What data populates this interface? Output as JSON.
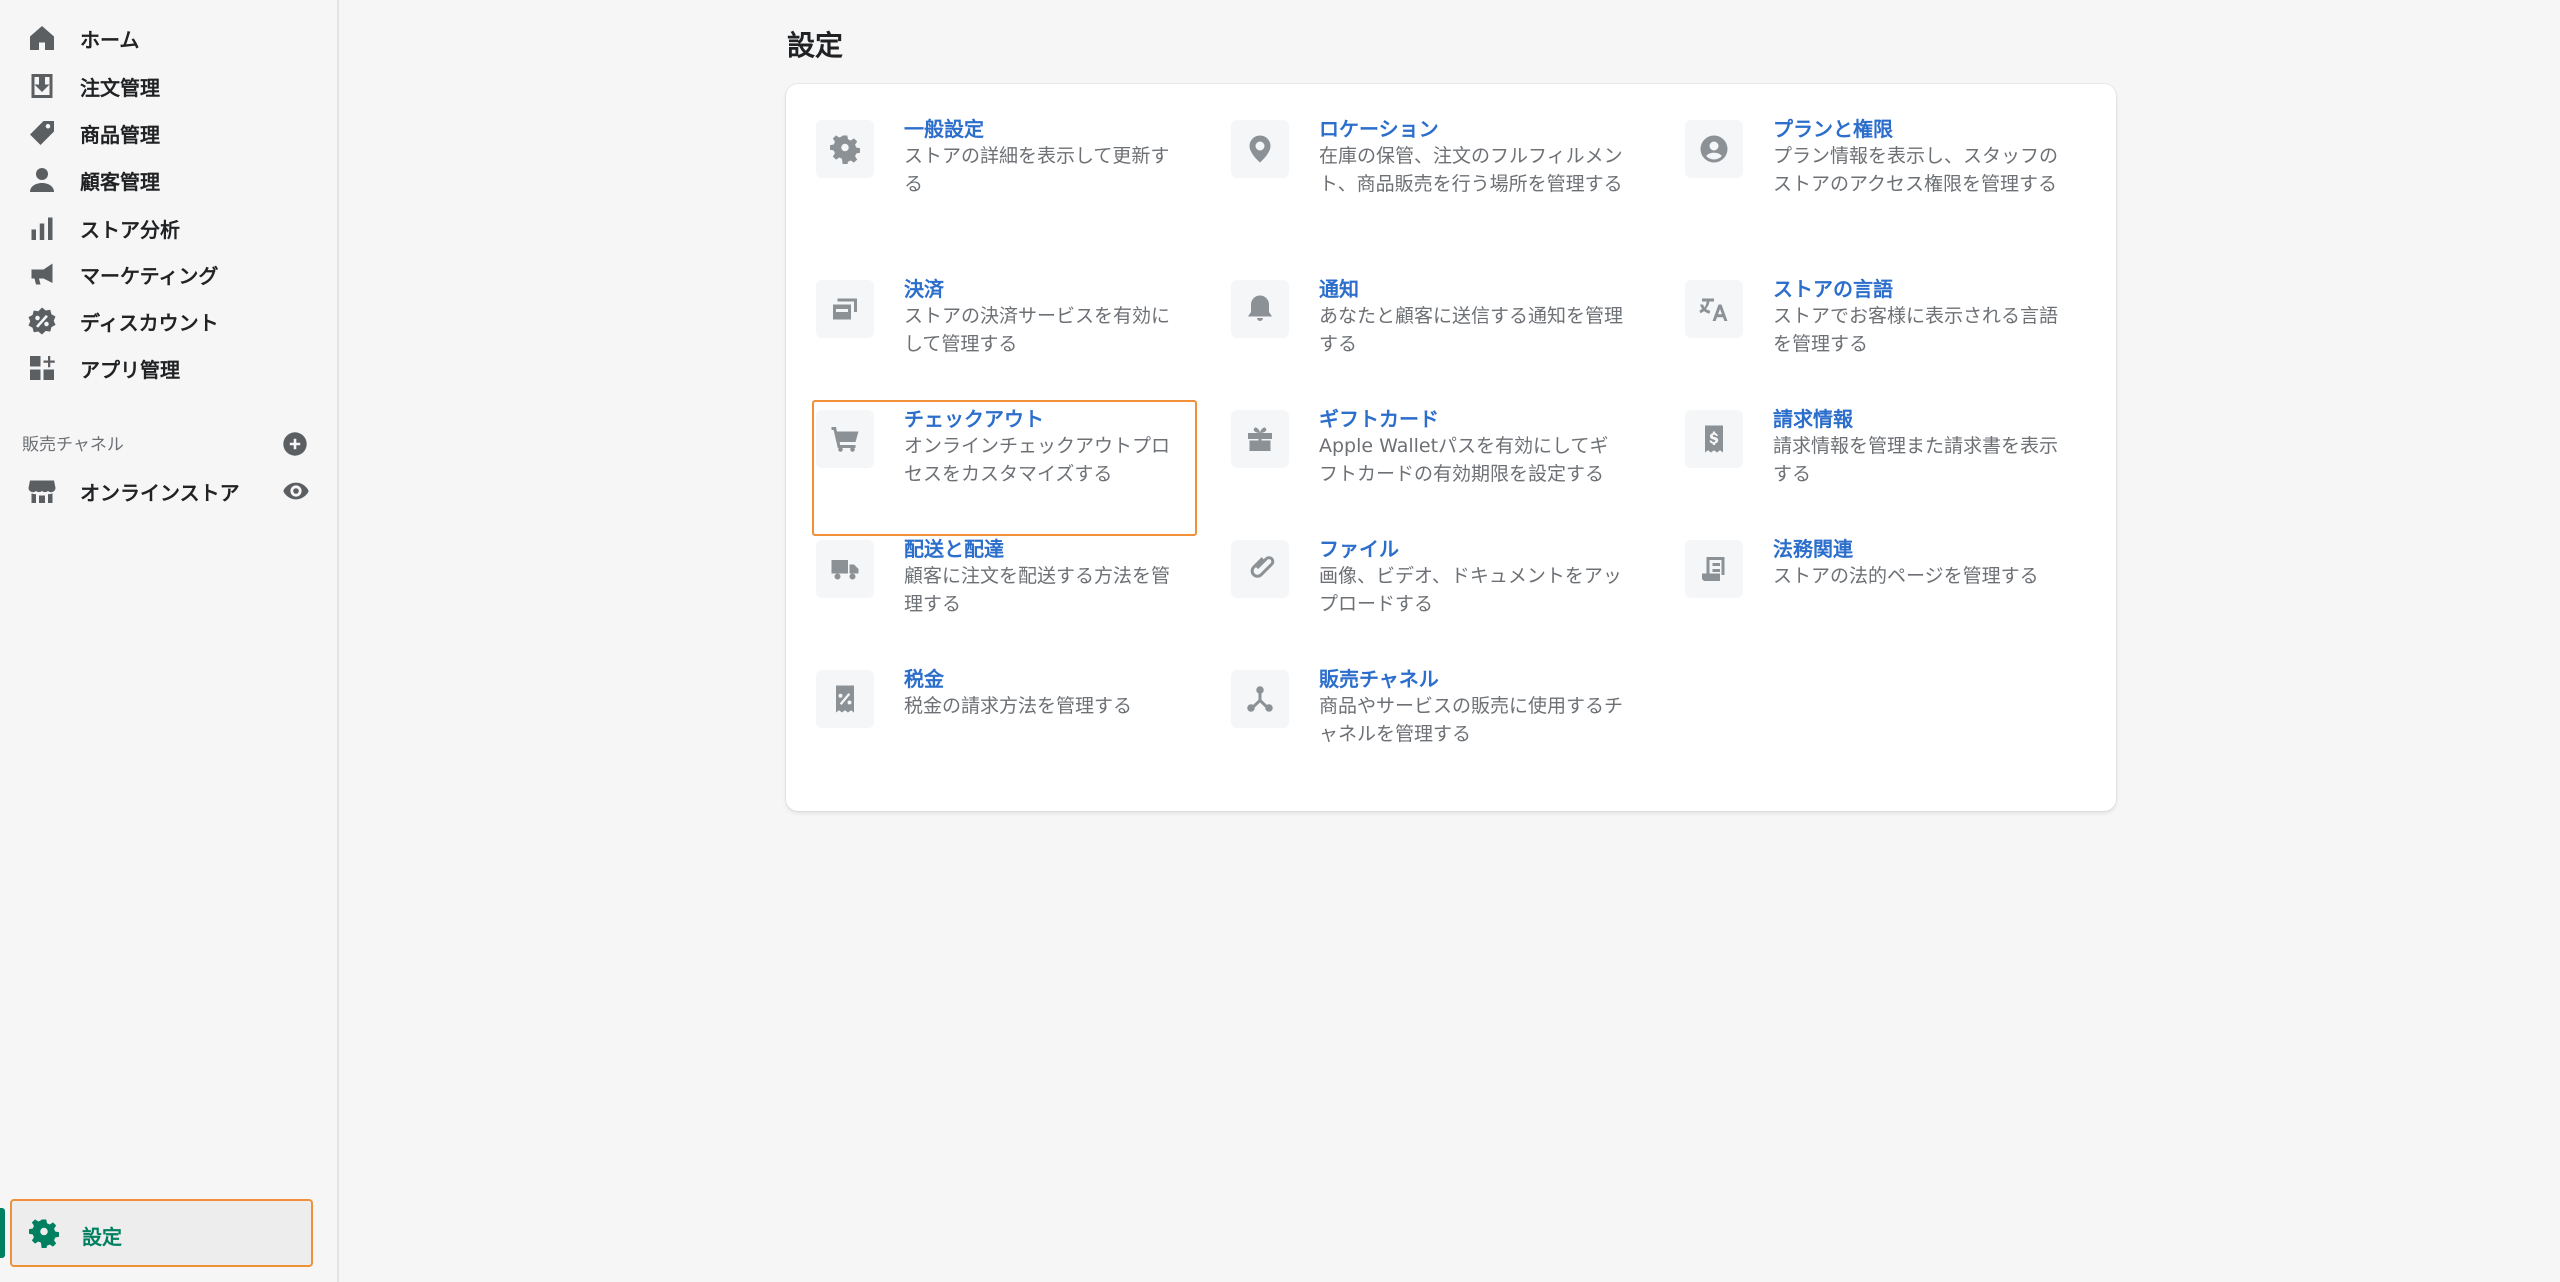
{
  "sidebar": {
    "nav": [
      {
        "label": "ホーム",
        "icon": "home-icon"
      },
      {
        "label": "注文管理",
        "icon": "orders-icon"
      },
      {
        "label": "商品管理",
        "icon": "tag-icon"
      },
      {
        "label": "顧客管理",
        "icon": "customer-icon"
      },
      {
        "label": "ストア分析",
        "icon": "analytics-icon"
      },
      {
        "label": "マーケティング",
        "icon": "megaphone-icon"
      },
      {
        "label": "ディスカウント",
        "icon": "discount-icon"
      },
      {
        "label": "アプリ管理",
        "icon": "apps-icon"
      }
    ],
    "channels_header": "販売チャネル",
    "channels": [
      {
        "label": "オンラインストア",
        "icon": "store-icon"
      }
    ],
    "settings_label": "設定"
  },
  "page": {
    "title": "設定"
  },
  "settings": [
    {
      "title": "一般設定",
      "desc": "ストアの詳細を表示して更新する",
      "icon": "gear-icon"
    },
    {
      "title": "ロケーション",
      "desc": "在庫の保管、注文のフルフィルメント、商品販売を行う場所を管理する",
      "icon": "location-icon"
    },
    {
      "title": "プランと権限",
      "desc": "プラン情報を表示し、スタッフのストアのアクセス権限を管理する",
      "icon": "user-circle-icon"
    },
    {
      "title": "決済",
      "desc": "ストアの決済サービスを有効にして管理する",
      "icon": "payment-icon"
    },
    {
      "title": "通知",
      "desc": "あなたと顧客に送信する通知を管理する",
      "icon": "bell-icon"
    },
    {
      "title": "ストアの言語",
      "desc": "ストアでお客様に表示される言語を管理する",
      "icon": "translate-icon"
    },
    {
      "title": "チェックアウト",
      "desc": "オンラインチェックアウトプロセスをカスタマイズする",
      "icon": "cart-icon"
    },
    {
      "title": "ギフトカード",
      "desc": "Apple Walletパスを有効にしてギフトカードの有効期限を設定する",
      "icon": "gift-icon"
    },
    {
      "title": "請求情報",
      "desc": "請求情報を管理また請求書を表示する",
      "icon": "receipt-icon"
    },
    {
      "title": "配送と配達",
      "desc": "顧客に注文を配送する方法を管理する",
      "icon": "truck-icon"
    },
    {
      "title": "ファイル",
      "desc": "画像、ビデオ、ドキュメントをアップロードする",
      "icon": "link-icon"
    },
    {
      "title": "法務関連",
      "desc": "ストアの法的ページを管理する",
      "icon": "document-icon"
    },
    {
      "title": "税金",
      "desc": "税金の請求方法を管理する",
      "icon": "tax-icon"
    },
    {
      "title": "販売チャネル",
      "desc": "商品やサービスの販売に使用するチャネルを管理する",
      "icon": "channels-icon"
    }
  ],
  "colors": {
    "accent": "#008060",
    "link": "#2c6ecb",
    "highlight": "#f0913a"
  }
}
